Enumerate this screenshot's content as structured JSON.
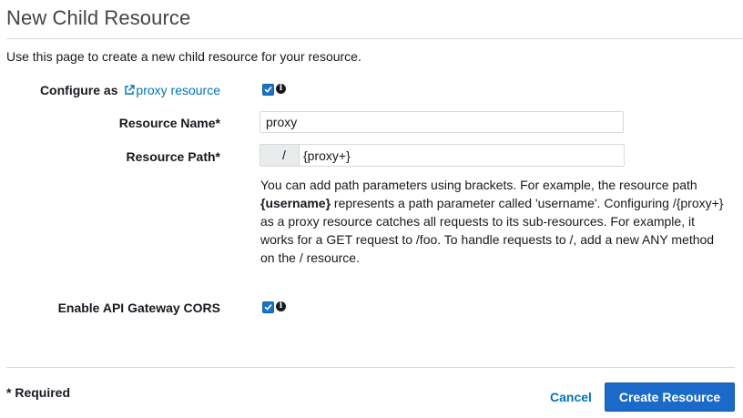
{
  "page": {
    "title": "New Child Resource",
    "description": "Use this page to create a new child resource for your resource."
  },
  "form": {
    "configure": {
      "label_prefix": "Configure as",
      "link_text": "proxy resource",
      "checked": true
    },
    "resource_name": {
      "label": "Resource Name*",
      "value": "proxy"
    },
    "resource_path": {
      "label": "Resource Path*",
      "prefix": "/",
      "value": "{proxy+}"
    },
    "help": {
      "line1": "You can add path parameters using brackets. For example, the resource path",
      "line2_bold": "{username}",
      "line2_rest": " represents a path parameter called 'username'. Configuring /{proxy+}",
      "line3": "as a proxy resource catches all requests to its sub-resources. For example, it",
      "line4": "works for a GET request to /foo. To handle requests to /, add a new ANY method",
      "line5": "on the / resource."
    },
    "cors": {
      "label": "Enable API Gateway CORS",
      "checked": true
    }
  },
  "footer": {
    "required_note": "* Required",
    "cancel_label": "Cancel",
    "create_label": "Create Resource"
  },
  "colors": {
    "link": "#0073bb",
    "primary_button": "#1b6ac9",
    "checkbox": "#1a73c8"
  },
  "icons": {
    "external_link": "external-link-icon",
    "info": "info-icon",
    "checkmark": "check-icon"
  }
}
